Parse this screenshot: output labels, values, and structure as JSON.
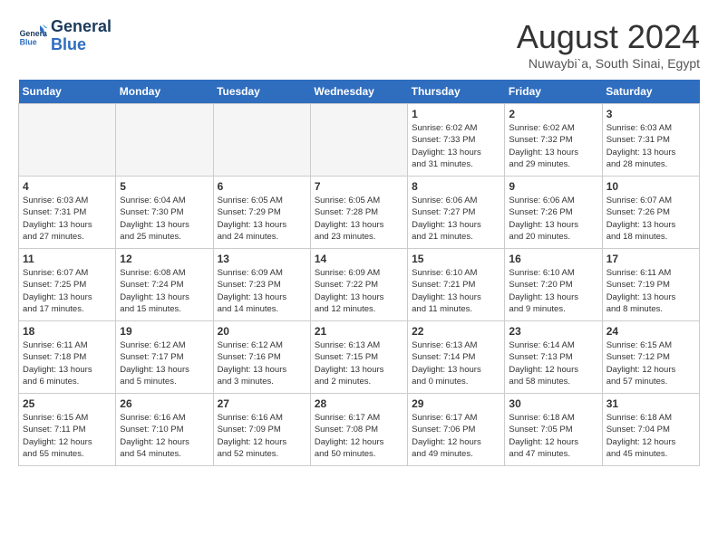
{
  "header": {
    "logo_line1": "General",
    "logo_line2": "Blue",
    "month_year": "August 2024",
    "location": "Nuwaybi`a, South Sinai, Egypt"
  },
  "weekdays": [
    "Sunday",
    "Monday",
    "Tuesday",
    "Wednesday",
    "Thursday",
    "Friday",
    "Saturday"
  ],
  "weeks": [
    [
      {
        "day": "",
        "detail": ""
      },
      {
        "day": "",
        "detail": ""
      },
      {
        "day": "",
        "detail": ""
      },
      {
        "day": "",
        "detail": ""
      },
      {
        "day": "1",
        "detail": "Sunrise: 6:02 AM\nSunset: 7:33 PM\nDaylight: 13 hours\nand 31 minutes."
      },
      {
        "day": "2",
        "detail": "Sunrise: 6:02 AM\nSunset: 7:32 PM\nDaylight: 13 hours\nand 29 minutes."
      },
      {
        "day": "3",
        "detail": "Sunrise: 6:03 AM\nSunset: 7:31 PM\nDaylight: 13 hours\nand 28 minutes."
      }
    ],
    [
      {
        "day": "4",
        "detail": "Sunrise: 6:03 AM\nSunset: 7:31 PM\nDaylight: 13 hours\nand 27 minutes."
      },
      {
        "day": "5",
        "detail": "Sunrise: 6:04 AM\nSunset: 7:30 PM\nDaylight: 13 hours\nand 25 minutes."
      },
      {
        "day": "6",
        "detail": "Sunrise: 6:05 AM\nSunset: 7:29 PM\nDaylight: 13 hours\nand 24 minutes."
      },
      {
        "day": "7",
        "detail": "Sunrise: 6:05 AM\nSunset: 7:28 PM\nDaylight: 13 hours\nand 23 minutes."
      },
      {
        "day": "8",
        "detail": "Sunrise: 6:06 AM\nSunset: 7:27 PM\nDaylight: 13 hours\nand 21 minutes."
      },
      {
        "day": "9",
        "detail": "Sunrise: 6:06 AM\nSunset: 7:26 PM\nDaylight: 13 hours\nand 20 minutes."
      },
      {
        "day": "10",
        "detail": "Sunrise: 6:07 AM\nSunset: 7:26 PM\nDaylight: 13 hours\nand 18 minutes."
      }
    ],
    [
      {
        "day": "11",
        "detail": "Sunrise: 6:07 AM\nSunset: 7:25 PM\nDaylight: 13 hours\nand 17 minutes."
      },
      {
        "day": "12",
        "detail": "Sunrise: 6:08 AM\nSunset: 7:24 PM\nDaylight: 13 hours\nand 15 minutes."
      },
      {
        "day": "13",
        "detail": "Sunrise: 6:09 AM\nSunset: 7:23 PM\nDaylight: 13 hours\nand 14 minutes."
      },
      {
        "day": "14",
        "detail": "Sunrise: 6:09 AM\nSunset: 7:22 PM\nDaylight: 13 hours\nand 12 minutes."
      },
      {
        "day": "15",
        "detail": "Sunrise: 6:10 AM\nSunset: 7:21 PM\nDaylight: 13 hours\nand 11 minutes."
      },
      {
        "day": "16",
        "detail": "Sunrise: 6:10 AM\nSunset: 7:20 PM\nDaylight: 13 hours\nand 9 minutes."
      },
      {
        "day": "17",
        "detail": "Sunrise: 6:11 AM\nSunset: 7:19 PM\nDaylight: 13 hours\nand 8 minutes."
      }
    ],
    [
      {
        "day": "18",
        "detail": "Sunrise: 6:11 AM\nSunset: 7:18 PM\nDaylight: 13 hours\nand 6 minutes."
      },
      {
        "day": "19",
        "detail": "Sunrise: 6:12 AM\nSunset: 7:17 PM\nDaylight: 13 hours\nand 5 minutes."
      },
      {
        "day": "20",
        "detail": "Sunrise: 6:12 AM\nSunset: 7:16 PM\nDaylight: 13 hours\nand 3 minutes."
      },
      {
        "day": "21",
        "detail": "Sunrise: 6:13 AM\nSunset: 7:15 PM\nDaylight: 13 hours\nand 2 minutes."
      },
      {
        "day": "22",
        "detail": "Sunrise: 6:13 AM\nSunset: 7:14 PM\nDaylight: 13 hours\nand 0 minutes."
      },
      {
        "day": "23",
        "detail": "Sunrise: 6:14 AM\nSunset: 7:13 PM\nDaylight: 12 hours\nand 58 minutes."
      },
      {
        "day": "24",
        "detail": "Sunrise: 6:15 AM\nSunset: 7:12 PM\nDaylight: 12 hours\nand 57 minutes."
      }
    ],
    [
      {
        "day": "25",
        "detail": "Sunrise: 6:15 AM\nSunset: 7:11 PM\nDaylight: 12 hours\nand 55 minutes."
      },
      {
        "day": "26",
        "detail": "Sunrise: 6:16 AM\nSunset: 7:10 PM\nDaylight: 12 hours\nand 54 minutes."
      },
      {
        "day": "27",
        "detail": "Sunrise: 6:16 AM\nSunset: 7:09 PM\nDaylight: 12 hours\nand 52 minutes."
      },
      {
        "day": "28",
        "detail": "Sunrise: 6:17 AM\nSunset: 7:08 PM\nDaylight: 12 hours\nand 50 minutes."
      },
      {
        "day": "29",
        "detail": "Sunrise: 6:17 AM\nSunset: 7:06 PM\nDaylight: 12 hours\nand 49 minutes."
      },
      {
        "day": "30",
        "detail": "Sunrise: 6:18 AM\nSunset: 7:05 PM\nDaylight: 12 hours\nand 47 minutes."
      },
      {
        "day": "31",
        "detail": "Sunrise: 6:18 AM\nSunset: 7:04 PM\nDaylight: 12 hours\nand 45 minutes."
      }
    ]
  ]
}
